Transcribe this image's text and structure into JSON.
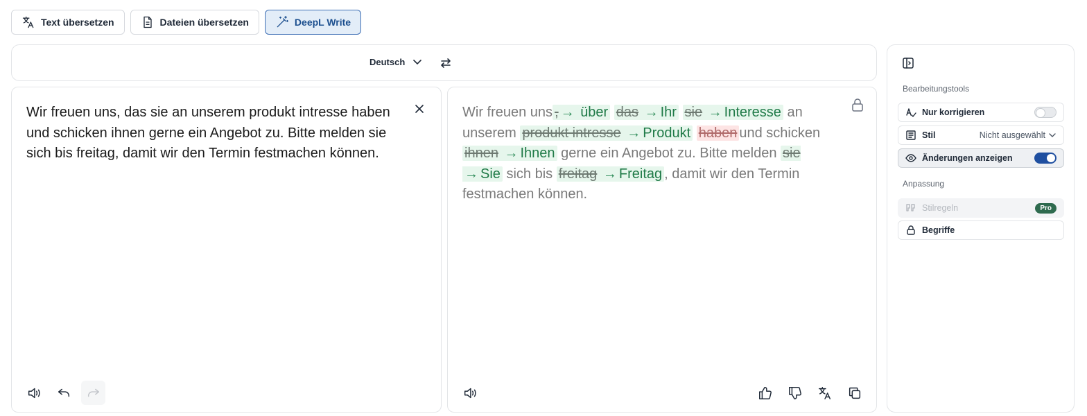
{
  "tabs": [
    {
      "label": "Text übersetzen",
      "icon": "translate-icon"
    },
    {
      "label": "Dateien übersetzen",
      "icon": "document-icon"
    },
    {
      "label": "DeepL Write",
      "icon": "magic-wand-icon"
    }
  ],
  "language": {
    "selected": "Deutsch"
  },
  "input": {
    "text": "Wir freuen uns, das sie an unserem produkt intresse haben und schicken ihnen gerne ein Angebot zu. Bitte melden sie sich bis freitag, damit wir den Termin festmachen können."
  },
  "output": {
    "t1": "Wir freuen uns",
    "c1_del": ",",
    "c1_ins": "über",
    "c2_del": "das",
    "c2_ins": "Ihr",
    "c3_del": "sie",
    "c3_ins": "Interesse",
    "t2": " an unserem ",
    "c4_del": "produkt intresse",
    "c4_ins": "Produkt",
    "c5_del": "haben",
    "t3": "und schicken ",
    "c6_del": "ihnen",
    "c6_ins": "Ihnen",
    "t4": " gerne ein Angebot zu. Bitte melden ",
    "c7_del": "sie",
    "c7_ins": "Sie",
    "t5": " sich bis ",
    "c8_del": "freitag",
    "c8_ins": "Freitag",
    "t6": ", damit wir den Termin festmachen können.",
    "arrow": "→"
  },
  "sidebar": {
    "section_tools": "Bearbeitungstools",
    "only_correct": "Nur korrigieren",
    "style_label": "Stil",
    "style_value": "Nicht ausgewählt",
    "show_changes": "Änderungen anzeigen",
    "section_custom": "Anpassung",
    "style_rules": "Stilregeln",
    "pro_badge": "Pro",
    "terms": "Begriffe"
  },
  "colors": {
    "accent": "#1f4fa0",
    "insert_bg": "#e6f6ec",
    "delete_bg": "#fde4e4",
    "pro_badge": "#2f6b4f"
  }
}
